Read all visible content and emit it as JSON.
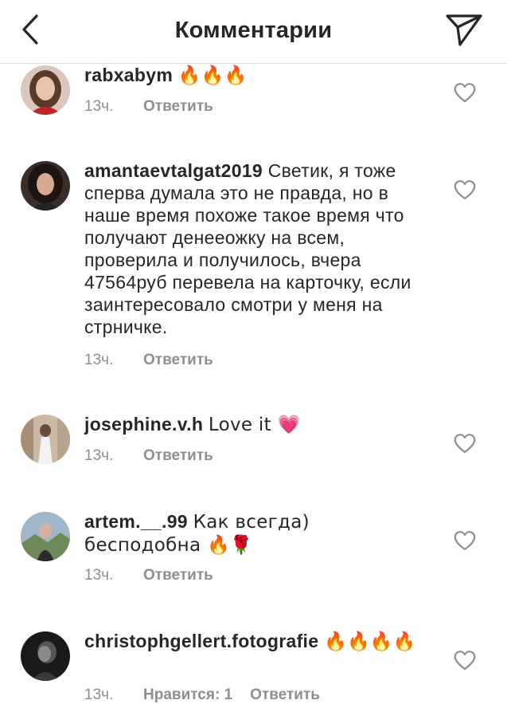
{
  "header": {
    "title": "Комментарии",
    "back_icon": "chevron-left-icon",
    "share_icon": "paper-plane-icon"
  },
  "comments": [
    {
      "username": "rabxabym",
      "text": "🔥🔥🔥",
      "time": "13ч.",
      "reply": "Ответить"
    },
    {
      "username": "amantaevtalgat2019",
      "text": "Светик, я тоже сперва думала это не правда, но в наше время похоже такое время что получают денееожку на всем, проверила и получилось, вчера 47564руб перевела на карточку, если заинтересовало смотри у меня на стрничке.",
      "time": "13ч.",
      "reply": "Ответить"
    },
    {
      "username": "josephine.v.h",
      "text": "Love it 💗",
      "time": "13ч.",
      "reply": "Ответить"
    },
    {
      "username": "artem.__.99",
      "text": "Как всегда) бесподобна 🔥🌹",
      "time": "13ч.",
      "reply": "Ответить"
    },
    {
      "username": "christophgellert.fotografie",
      "text": "🔥🔥🔥🔥",
      "time": "13ч.",
      "replies": "Нравится: 1",
      "reply": "Ответить"
    }
  ],
  "colors": {
    "text": "#262626",
    "meta": "#8e8e8e",
    "divider": "#dbdbdb"
  }
}
